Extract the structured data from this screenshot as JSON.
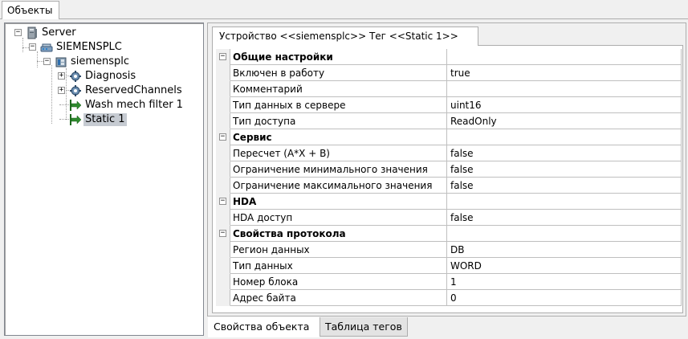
{
  "window": {
    "tab_label": "Объекты"
  },
  "tree": {
    "nodes": [
      {
        "label": "Server",
        "icon": "server-icon",
        "expander": "−"
      },
      {
        "label": "SIEMENSPLC",
        "icon": "network-icon",
        "expander": "−"
      },
      {
        "label": "siemensplc",
        "icon": "device-icon",
        "expander": "−"
      },
      {
        "label": "Diagnosis",
        "icon": "gear-icon",
        "expander": "+"
      },
      {
        "label": "ReservedChannels",
        "icon": "gear-icon",
        "expander": "+"
      },
      {
        "label": "Wash mech filter 1",
        "icon": "tag-arrow-icon"
      },
      {
        "label": "Static 1",
        "icon": "tag-arrow-icon",
        "selected": true
      }
    ]
  },
  "properties": {
    "tab_label": "Устройство <<siemensplc>> Тег  <<Static 1>>",
    "rows": [
      {
        "type": "category",
        "name": "Общие настройки",
        "value": ""
      },
      {
        "type": "prop",
        "name": "Включен в работу",
        "value": "true"
      },
      {
        "type": "prop",
        "name": "Комментарий",
        "value": ""
      },
      {
        "type": "prop",
        "name": "Тип данных в сервере",
        "value": "uint16"
      },
      {
        "type": "prop",
        "name": "Тип доступа",
        "value": "ReadOnly"
      },
      {
        "type": "category",
        "name": "Сервис",
        "value": ""
      },
      {
        "type": "prop",
        "name": "Пересчет (A*X + B)",
        "value": "false"
      },
      {
        "type": "prop",
        "name": "Ограничение минимального значения",
        "value": "false"
      },
      {
        "type": "prop",
        "name": "Ограничение максимального значения",
        "value": "false"
      },
      {
        "type": "category",
        "name": "HDA",
        "value": ""
      },
      {
        "type": "prop",
        "name": "HDA доступ",
        "value": "false"
      },
      {
        "type": "category",
        "name": "Свойства протокола",
        "value": ""
      },
      {
        "type": "prop",
        "name": "Регион данных",
        "value": "DB"
      },
      {
        "type": "prop",
        "name": "Тип данных",
        "value": "WORD"
      },
      {
        "type": "prop",
        "name": "Номер блока",
        "value": "1"
      },
      {
        "type": "prop",
        "name": "Адрес байта",
        "value": "0"
      }
    ]
  },
  "bottom_tabs": {
    "object_properties": "Свойства объекта",
    "tag_table": "Таблица тегов"
  },
  "colors": {
    "selection": "#c6cbd2",
    "border": "#adadad",
    "arrow_green": "#2e8b2e"
  }
}
